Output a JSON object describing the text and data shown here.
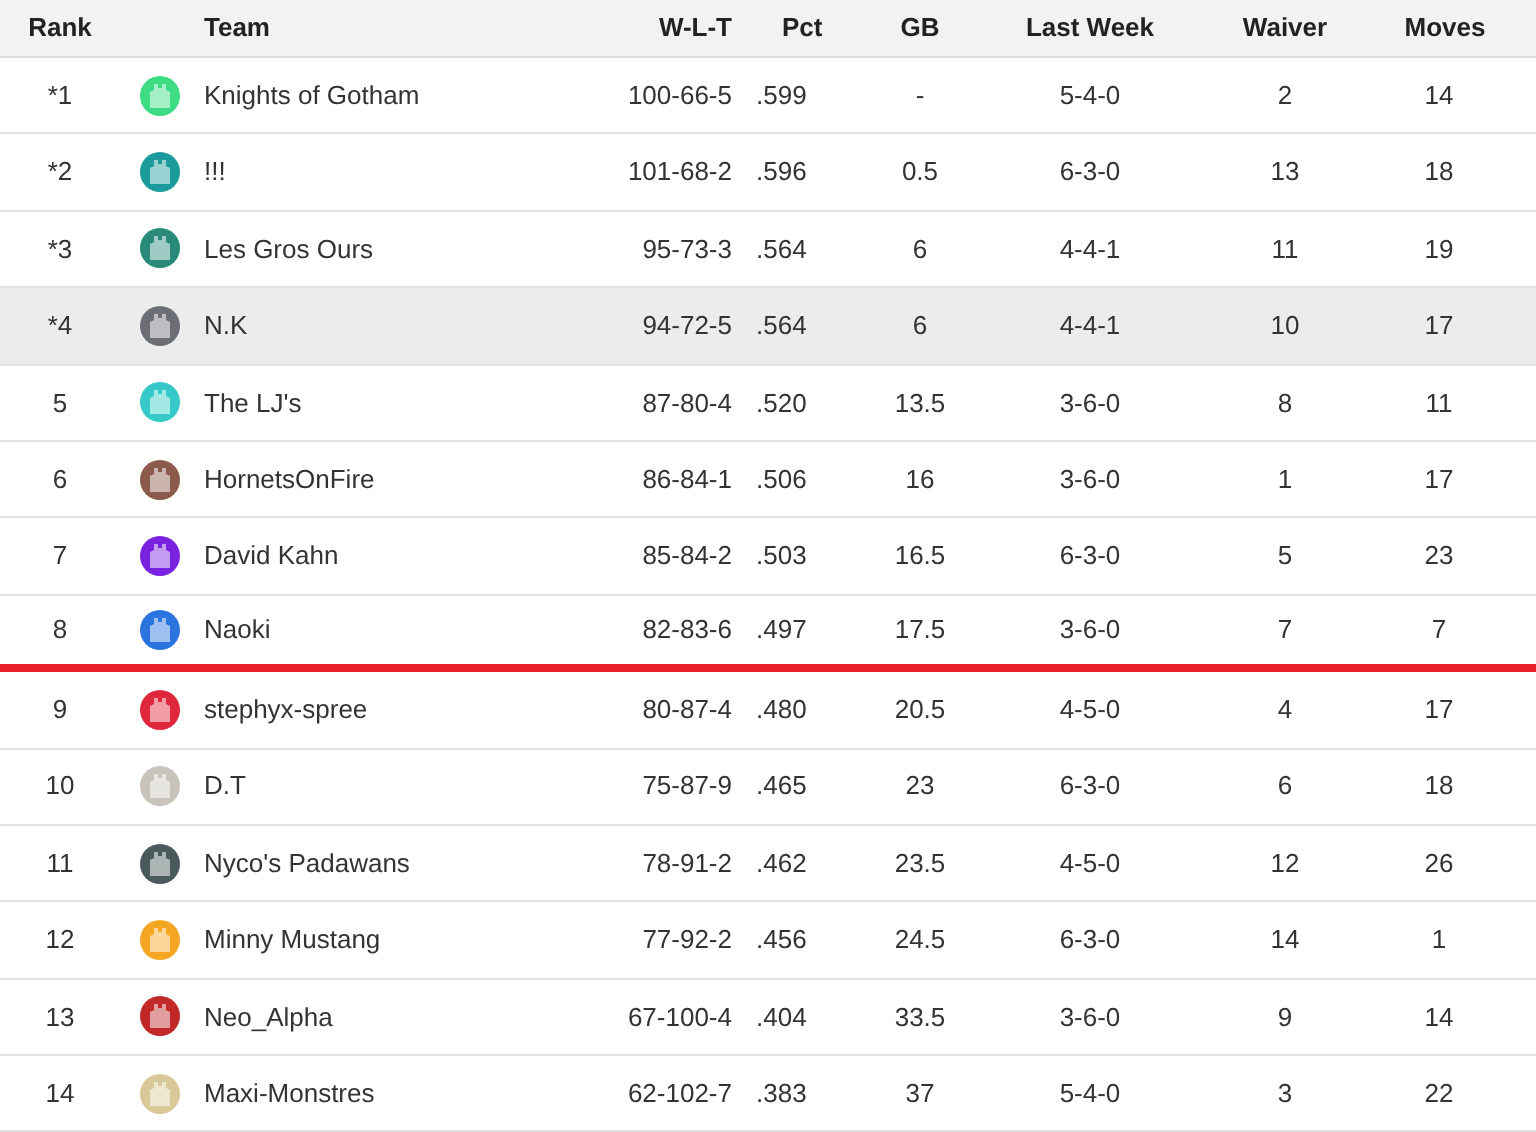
{
  "columns": [
    "Rank",
    "Team",
    "W-L-T",
    "Pct",
    "GB",
    "Last Week",
    "Waiver",
    "Moves"
  ],
  "rows": [
    {
      "rank": "*1",
      "team": "Knights of Gotham",
      "color": "#3ddc84",
      "wlt": "100-66-5",
      "pct": ".599",
      "gb": "-",
      "last_week": "5-4-0",
      "waiver": "2",
      "moves": "14",
      "selected": false,
      "cutoff_after": false
    },
    {
      "rank": "*2",
      "team": "!!!",
      "color": "#1a9a9a",
      "wlt": "101-68-2",
      "pct": ".596",
      "gb": "0.5",
      "last_week": "6-3-0",
      "waiver": "13",
      "moves": "18",
      "selected": false,
      "cutoff_after": false
    },
    {
      "rank": "*3",
      "team": "Les Gros Ours",
      "color": "#2a8a7a",
      "wlt": "95-73-3",
      "pct": ".564",
      "gb": "6",
      "last_week": "4-4-1",
      "waiver": "11",
      "moves": "19",
      "selected": false,
      "cutoff_after": false
    },
    {
      "rank": "*4",
      "team": "N.K",
      "color": "#6b6f75",
      "wlt": "94-72-5",
      "pct": ".564",
      "gb": "6",
      "last_week": "4-4-1",
      "waiver": "10",
      "moves": "17",
      "selected": true,
      "cutoff_after": false
    },
    {
      "rank": "5",
      "team": "The LJ's",
      "color": "#35c9c9",
      "wlt": "87-80-4",
      "pct": ".520",
      "gb": "13.5",
      "last_week": "3-6-0",
      "waiver": "8",
      "moves": "11",
      "selected": false,
      "cutoff_after": false
    },
    {
      "rank": "6",
      "team": "HornetsOnFire",
      "color": "#8a5a4a",
      "wlt": "86-84-1",
      "pct": ".506",
      "gb": "16",
      "last_week": "3-6-0",
      "waiver": "1",
      "moves": "17",
      "selected": false,
      "cutoff_after": false
    },
    {
      "rank": "7",
      "team": "David Kahn",
      "color": "#7a22e0",
      "wlt": "85-84-2",
      "pct": ".503",
      "gb": "16.5",
      "last_week": "6-3-0",
      "waiver": "5",
      "moves": "23",
      "selected": false,
      "cutoff_after": false
    },
    {
      "rank": "8",
      "team": "Naoki",
      "color": "#2a74e0",
      "wlt": "82-83-6",
      "pct": ".497",
      "gb": "17.5",
      "last_week": "3-6-0",
      "waiver": "7",
      "moves": "7",
      "selected": false,
      "cutoff_after": true
    },
    {
      "rank": "9",
      "team": "stephyx-spree",
      "color": "#e0283c",
      "wlt": "80-87-4",
      "pct": ".480",
      "gb": "20.5",
      "last_week": "4-5-0",
      "waiver": "4",
      "moves": "17",
      "selected": false,
      "cutoff_after": false
    },
    {
      "rank": "10",
      "team": "D.T",
      "color": "#c8c4bc",
      "wlt": "75-87-9",
      "pct": ".465",
      "gb": "23",
      "last_week": "6-3-0",
      "waiver": "6",
      "moves": "18",
      "selected": false,
      "cutoff_after": false
    },
    {
      "rank": "11",
      "team": "Nyco's Padawans",
      "color": "#4a5a5a",
      "wlt": "78-91-2",
      "pct": ".462",
      "gb": "23.5",
      "last_week": "4-5-0",
      "waiver": "12",
      "moves": "26",
      "selected": false,
      "cutoff_after": false
    },
    {
      "rank": "12",
      "team": "Minny Mustang",
      "color": "#f5a623",
      "wlt": "77-92-2",
      "pct": ".456",
      "gb": "24.5",
      "last_week": "6-3-0",
      "waiver": "14",
      "moves": "1",
      "selected": false,
      "cutoff_after": false
    },
    {
      "rank": "13",
      "team": "Neo_Alpha",
      "color": "#c0282a",
      "wlt": "67-100-4",
      "pct": ".404",
      "gb": "33.5",
      "last_week": "3-6-0",
      "waiver": "9",
      "moves": "14",
      "selected": false,
      "cutoff_after": false
    },
    {
      "rank": "14",
      "team": "Maxi-Monstres",
      "color": "#d8c89a",
      "wlt": "62-102-7",
      "pct": ".383",
      "gb": "37",
      "last_week": "5-4-0",
      "waiver": "3",
      "moves": "22",
      "selected": false,
      "cutoff_after": false
    }
  ]
}
